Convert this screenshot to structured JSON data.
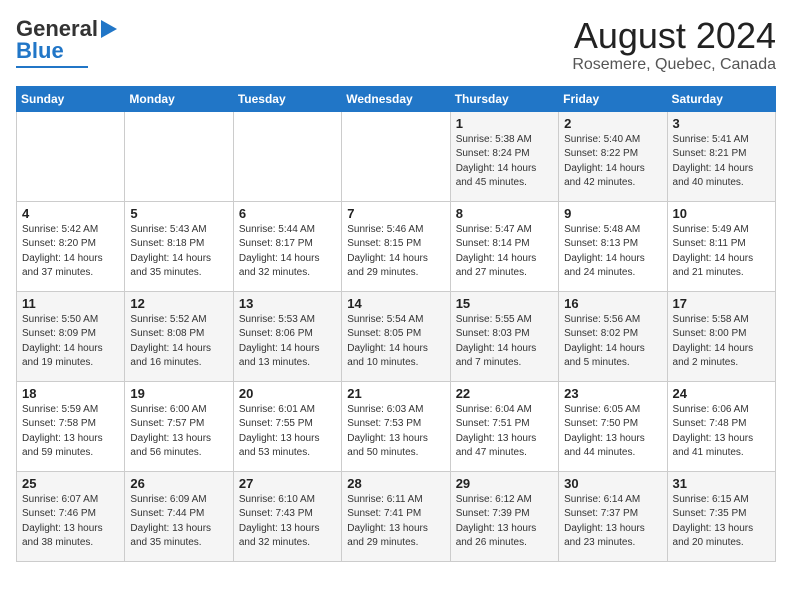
{
  "header": {
    "logo_general": "General",
    "logo_blue": "Blue",
    "month_title": "August 2024",
    "location": "Rosemere, Quebec, Canada"
  },
  "days_of_week": [
    "Sunday",
    "Monday",
    "Tuesday",
    "Wednesday",
    "Thursday",
    "Friday",
    "Saturday"
  ],
  "weeks": [
    [
      {
        "day": "",
        "info": ""
      },
      {
        "day": "",
        "info": ""
      },
      {
        "day": "",
        "info": ""
      },
      {
        "day": "",
        "info": ""
      },
      {
        "day": "1",
        "info": "Sunrise: 5:38 AM\nSunset: 8:24 PM\nDaylight: 14 hours\nand 45 minutes."
      },
      {
        "day": "2",
        "info": "Sunrise: 5:40 AM\nSunset: 8:22 PM\nDaylight: 14 hours\nand 42 minutes."
      },
      {
        "day": "3",
        "info": "Sunrise: 5:41 AM\nSunset: 8:21 PM\nDaylight: 14 hours\nand 40 minutes."
      }
    ],
    [
      {
        "day": "4",
        "info": "Sunrise: 5:42 AM\nSunset: 8:20 PM\nDaylight: 14 hours\nand 37 minutes."
      },
      {
        "day": "5",
        "info": "Sunrise: 5:43 AM\nSunset: 8:18 PM\nDaylight: 14 hours\nand 35 minutes."
      },
      {
        "day": "6",
        "info": "Sunrise: 5:44 AM\nSunset: 8:17 PM\nDaylight: 14 hours\nand 32 minutes."
      },
      {
        "day": "7",
        "info": "Sunrise: 5:46 AM\nSunset: 8:15 PM\nDaylight: 14 hours\nand 29 minutes."
      },
      {
        "day": "8",
        "info": "Sunrise: 5:47 AM\nSunset: 8:14 PM\nDaylight: 14 hours\nand 27 minutes."
      },
      {
        "day": "9",
        "info": "Sunrise: 5:48 AM\nSunset: 8:13 PM\nDaylight: 14 hours\nand 24 minutes."
      },
      {
        "day": "10",
        "info": "Sunrise: 5:49 AM\nSunset: 8:11 PM\nDaylight: 14 hours\nand 21 minutes."
      }
    ],
    [
      {
        "day": "11",
        "info": "Sunrise: 5:50 AM\nSunset: 8:09 PM\nDaylight: 14 hours\nand 19 minutes."
      },
      {
        "day": "12",
        "info": "Sunrise: 5:52 AM\nSunset: 8:08 PM\nDaylight: 14 hours\nand 16 minutes."
      },
      {
        "day": "13",
        "info": "Sunrise: 5:53 AM\nSunset: 8:06 PM\nDaylight: 14 hours\nand 13 minutes."
      },
      {
        "day": "14",
        "info": "Sunrise: 5:54 AM\nSunset: 8:05 PM\nDaylight: 14 hours\nand 10 minutes."
      },
      {
        "day": "15",
        "info": "Sunrise: 5:55 AM\nSunset: 8:03 PM\nDaylight: 14 hours\nand 7 minutes."
      },
      {
        "day": "16",
        "info": "Sunrise: 5:56 AM\nSunset: 8:02 PM\nDaylight: 14 hours\nand 5 minutes."
      },
      {
        "day": "17",
        "info": "Sunrise: 5:58 AM\nSunset: 8:00 PM\nDaylight: 14 hours\nand 2 minutes."
      }
    ],
    [
      {
        "day": "18",
        "info": "Sunrise: 5:59 AM\nSunset: 7:58 PM\nDaylight: 13 hours\nand 59 minutes."
      },
      {
        "day": "19",
        "info": "Sunrise: 6:00 AM\nSunset: 7:57 PM\nDaylight: 13 hours\nand 56 minutes."
      },
      {
        "day": "20",
        "info": "Sunrise: 6:01 AM\nSunset: 7:55 PM\nDaylight: 13 hours\nand 53 minutes."
      },
      {
        "day": "21",
        "info": "Sunrise: 6:03 AM\nSunset: 7:53 PM\nDaylight: 13 hours\nand 50 minutes."
      },
      {
        "day": "22",
        "info": "Sunrise: 6:04 AM\nSunset: 7:51 PM\nDaylight: 13 hours\nand 47 minutes."
      },
      {
        "day": "23",
        "info": "Sunrise: 6:05 AM\nSunset: 7:50 PM\nDaylight: 13 hours\nand 44 minutes."
      },
      {
        "day": "24",
        "info": "Sunrise: 6:06 AM\nSunset: 7:48 PM\nDaylight: 13 hours\nand 41 minutes."
      }
    ],
    [
      {
        "day": "25",
        "info": "Sunrise: 6:07 AM\nSunset: 7:46 PM\nDaylight: 13 hours\nand 38 minutes."
      },
      {
        "day": "26",
        "info": "Sunrise: 6:09 AM\nSunset: 7:44 PM\nDaylight: 13 hours\nand 35 minutes."
      },
      {
        "day": "27",
        "info": "Sunrise: 6:10 AM\nSunset: 7:43 PM\nDaylight: 13 hours\nand 32 minutes."
      },
      {
        "day": "28",
        "info": "Sunrise: 6:11 AM\nSunset: 7:41 PM\nDaylight: 13 hours\nand 29 minutes."
      },
      {
        "day": "29",
        "info": "Sunrise: 6:12 AM\nSunset: 7:39 PM\nDaylight: 13 hours\nand 26 minutes."
      },
      {
        "day": "30",
        "info": "Sunrise: 6:14 AM\nSunset: 7:37 PM\nDaylight: 13 hours\nand 23 minutes."
      },
      {
        "day": "31",
        "info": "Sunrise: 6:15 AM\nSunset: 7:35 PM\nDaylight: 13 hours\nand 20 minutes."
      }
    ]
  ]
}
